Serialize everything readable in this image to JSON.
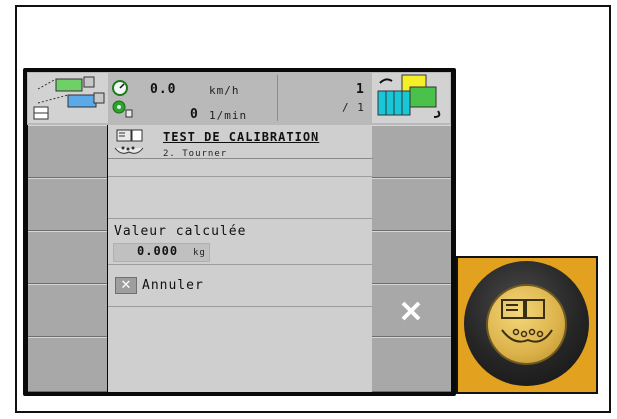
{
  "status": {
    "speed_value": "0.0",
    "speed_unit": "km/h",
    "rpm_value": "0",
    "rpm_unit": "1/min",
    "section_current": "1",
    "section_total": "/ 1"
  },
  "dialog": {
    "title": "TEST DE CALIBRATION",
    "step": "2. Tourner",
    "value_label": "Valeur calculée",
    "value": "0.000",
    "value_unit": "kg",
    "cancel_label": "Annuler",
    "cancel_icon": "x-icon",
    "title_icon": "calibration-icon"
  },
  "right_soft_keys": {
    "cancel_icon": "close-icon"
  },
  "knob": {
    "icon": "calibration-icon",
    "color_frame": "#e2a21f"
  }
}
